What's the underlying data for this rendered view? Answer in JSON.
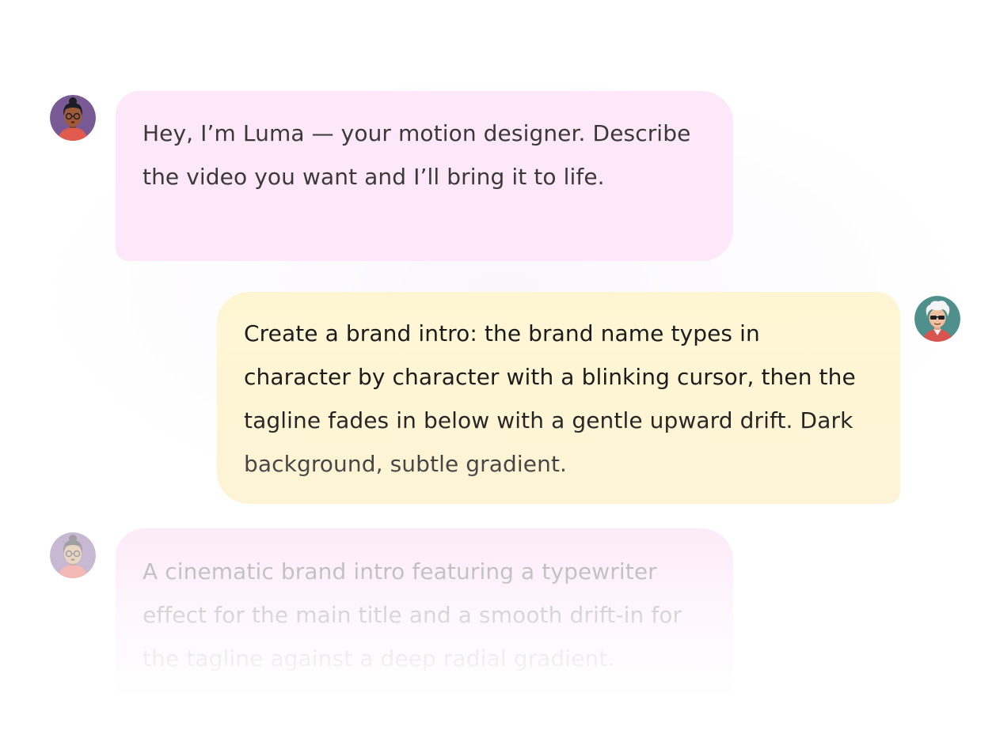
{
  "messages": [
    {
      "role": "assistant",
      "avatar": "assistant-avatar-icon",
      "text": "Hey, I’m Luma — your motion designer. Describe the video you want and I’ll bring it to life."
    },
    {
      "role": "user",
      "avatar": "user-avatar-icon",
      "text": "Create a brand intro: the brand name types in character by character with a blinking cursor, then the tagline fades in below with a gentle upward drift. Dark background, subtle gradient."
    },
    {
      "role": "assistant",
      "avatar": "assistant-avatar-icon",
      "text": "A cinematic brand intro featuring a typewriter effect for the main title and a smooth drift-in for the tagline against a deep radial gradient."
    }
  ],
  "colors": {
    "assistant_bubble": "#fce8f8",
    "user_bubble": "#fef6d3",
    "assistant_avatar_bg": "#7a5a94",
    "user_avatar_bg": "#4f8f8c"
  }
}
